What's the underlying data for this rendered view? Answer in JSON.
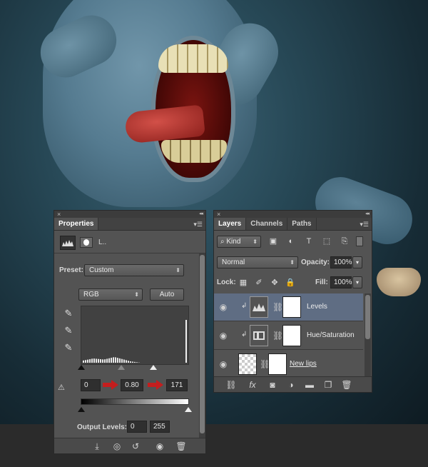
{
  "properties_panel": {
    "close": "×",
    "collapse": "◂◂",
    "tab": "Properties",
    "menu_icon": "hamburger-menu-icon",
    "header_label": "L..",
    "preset_label": "Preset:",
    "preset_value": "Custom",
    "channel_value": "RGB",
    "auto_label": "Auto",
    "input_black": "0",
    "input_gamma": "0.80",
    "input_white": "171",
    "output_label": "Output Levels:",
    "output_black": "0",
    "output_white": "255",
    "levels": {
      "input_black": 0,
      "input_gamma": 0.8,
      "input_white": 171,
      "output_black": 0,
      "output_white": 255
    }
  },
  "layers_panel": {
    "close": "×",
    "collapse": "◂◂",
    "tabs": [
      "Layers",
      "Channels",
      "Paths"
    ],
    "kind_label": "Kind",
    "blend_mode": "Normal",
    "opacity_label": "Opacity:",
    "opacity_value": "100%",
    "lock_label": "Lock:",
    "fill_label": "Fill:",
    "fill_value": "100%",
    "layers": [
      {
        "name": "Levels",
        "selected": true
      },
      {
        "name": "Hue/Saturation",
        "selected": false
      },
      {
        "name": "New lips",
        "selected": false
      }
    ]
  },
  "colors": {
    "panel": "#535353",
    "selected_row": "#5f6d83",
    "red_arrow": "#c41e1e"
  }
}
